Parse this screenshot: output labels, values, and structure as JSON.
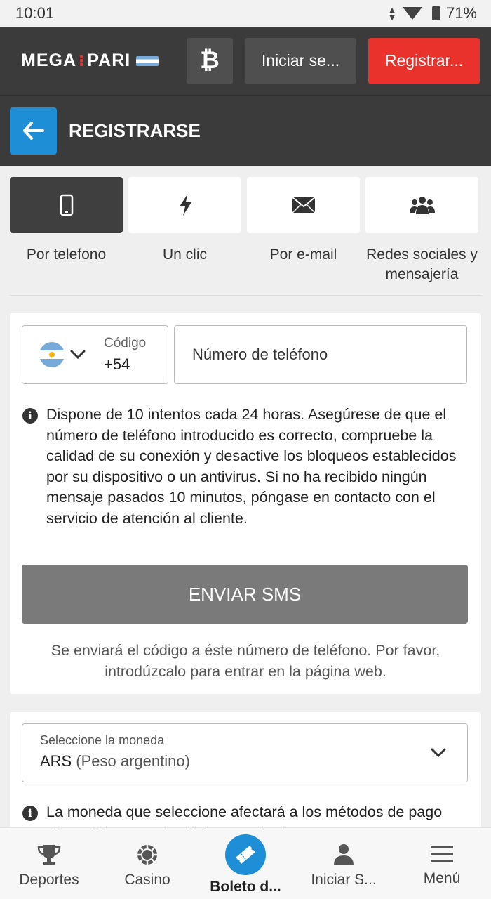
{
  "status_bar": {
    "time": "10:01",
    "battery": "71%"
  },
  "header": {
    "logo_left": "MEGA",
    "logo_right": "PARI",
    "login_label": "Iniciar se...",
    "register_label": "Registrar..."
  },
  "titlebar": {
    "title": "REGISTRARSE"
  },
  "methods": [
    {
      "label": "Por telefono",
      "icon": "smartphone-icon",
      "active": true
    },
    {
      "label": "Un clic",
      "icon": "lightning-icon",
      "active": false
    },
    {
      "label": "Por e-mail",
      "icon": "envelope-icon",
      "active": false
    },
    {
      "label": "Redes sociales y mensajería",
      "icon": "users-icon",
      "active": false
    }
  ],
  "phone_form": {
    "code_label": "Código",
    "code_value": "+54",
    "phone_placeholder": "Número de teléfono",
    "info_text": "Dispone de 10 intentos cada 24 horas. Asegúrese de que el número de teléfono introducido es correcto, compruebe la calidad de su conexión y desactive los bloqueos establecidos por su dispositivo o un antivirus. Si no ha recibido ningún mensaje pasados 10 minutos, póngase en contacto con el servicio de atención al cliente.",
    "send_sms_label": "ENVIAR SMS",
    "sms_note": "Se enviará el código a éste número de teléfono. Por favor, introdúzcalo para entrar en la página web."
  },
  "currency": {
    "label": "Seleccione la moneda",
    "code": "ARS",
    "name": "(Peso argentino)",
    "info_text": "La moneda que seleccione afectará a los métodos de pago disponibles para depósitos y retiradas"
  },
  "bottom_nav": [
    {
      "label": "Deportes",
      "icon": "trophy-icon"
    },
    {
      "label": "Casino",
      "icon": "casino-chip-icon"
    },
    {
      "label": "Boleto d...",
      "icon": "ticket-icon"
    },
    {
      "label": "Iniciar S...",
      "icon": "user-icon"
    },
    {
      "label": "Menú",
      "icon": "hamburger-menu-icon"
    }
  ],
  "colors": {
    "header_bg": "#3b3b3b",
    "register_red": "#e8322b",
    "accent_blue": "#1e8fd6",
    "sms_button_gray": "#7a7a7a"
  }
}
